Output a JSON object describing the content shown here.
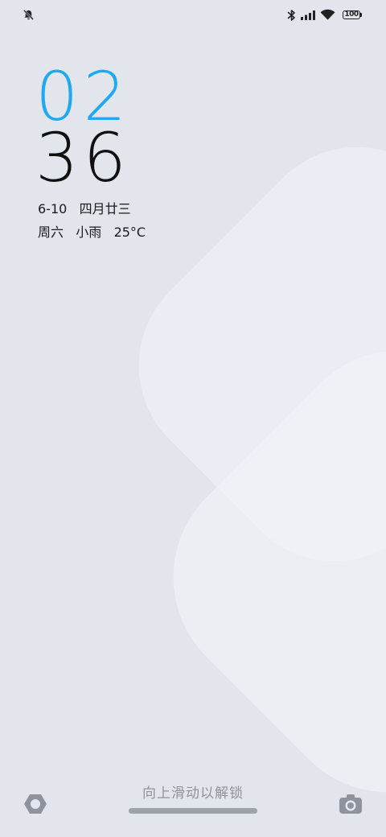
{
  "status_bar": {
    "battery_level": "100",
    "icons": [
      "notifications-muted-icon",
      "bluetooth-icon",
      "cellular-signal-icon",
      "wifi-icon",
      "battery-icon"
    ]
  },
  "lockscreen": {
    "clock": {
      "hour": "02",
      "minute": "36"
    },
    "date": {
      "gregorian": "6-10",
      "lunar": "四月廿三"
    },
    "weather": {
      "weekday": "周六",
      "condition": "小雨",
      "temperature": "25°C"
    },
    "unlock_hint": "向上滑动以解锁",
    "shortcuts": {
      "left_icon": "smart-home-icon",
      "right_icon": "camera-icon"
    }
  },
  "colors": {
    "hour_accent": "#1ea9f0",
    "minute_text": "#111111",
    "background": "#e2e5ec"
  }
}
